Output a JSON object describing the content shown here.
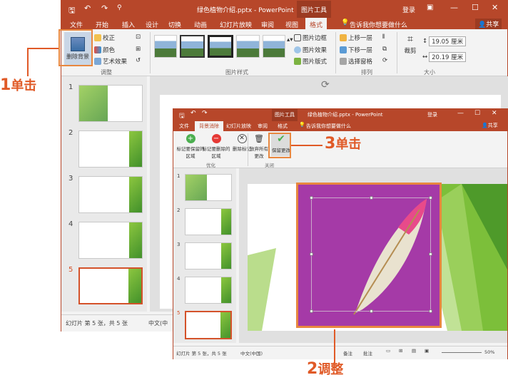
{
  "back_window": {
    "title": "绿色植物介绍.pptx - PowerPoint",
    "context_tab_group": "图片工具",
    "login": "登录",
    "tabs": [
      "文件",
      "开始",
      "插入",
      "设计",
      "切换",
      "动画",
      "幻灯片放映",
      "审阅",
      "视图",
      "格式"
    ],
    "tell_me": "告诉我你想要做什么",
    "share": "共享",
    "ribbon": {
      "remove_bg": "删除背景",
      "corrections": "校正",
      "color": "颜色",
      "artistic": "艺术效果",
      "adjust_label": "调整",
      "styles_label": "图片样式",
      "picture_border": "图片边框",
      "picture_effects": "图片效果",
      "picture_layout": "图片版式",
      "bring_forward": "上移一层",
      "send_backward": "下移一层",
      "selection_pane": "选择窗格",
      "arrange_label": "排列",
      "crop": "裁剪",
      "height": "19.05 厘米",
      "width": "20.19 厘米",
      "size_label": "大小"
    },
    "slides": [
      "1",
      "2",
      "3",
      "4",
      "5"
    ],
    "status": "幻灯片 第 5 张，共 5 张",
    "status_lang": "中文(中"
  },
  "front_window": {
    "title": "绿色植物介绍.pptx - PowerPoint",
    "context_tab_group": "图片工具",
    "login": "登录",
    "tabs": [
      "文件",
      "背景消除",
      "幻灯片放映",
      "审阅",
      "格式"
    ],
    "tell_me": "告诉我你想要做什么",
    "share": "共享",
    "ribbon": {
      "mark_keep": "标记要保留的区域",
      "mark_remove": "标记要删除的区域",
      "delete_mark": "删除标记",
      "refine_label": "优化",
      "discard": "放弃所有更改",
      "keep": "保留更改",
      "close_label": "关闭"
    },
    "slides": [
      "1",
      "2",
      "3",
      "4",
      "5"
    ],
    "status": "幻灯片 第 5 张，共 5 张",
    "status_lang": "中文(中国)",
    "notes": "备注",
    "comments": "批注",
    "zoom": "50%"
  },
  "annotations": {
    "step1_num": "1",
    "step1_text": "单击",
    "step2_num": "2",
    "step2_text": "调整",
    "step3_num": "3",
    "step3_text": "单击"
  },
  "colors": {
    "accent": "#b7472a",
    "callout": "#e05a27",
    "image_bg": "#a53aa7"
  }
}
